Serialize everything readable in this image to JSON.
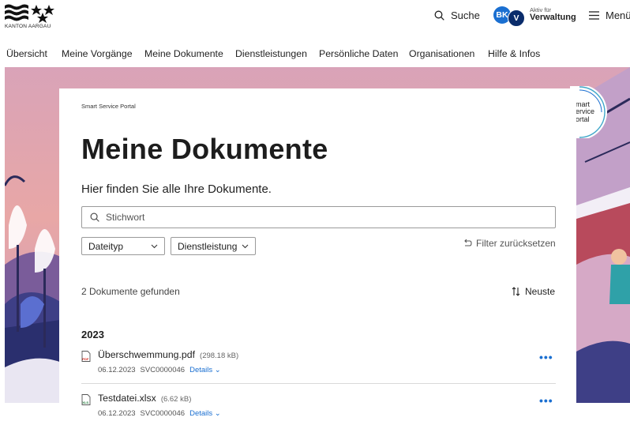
{
  "header": {
    "logo_text": "KANTON AARGAU",
    "search_label": "Suche",
    "avatar_initials": [
      "BK",
      "V"
    ],
    "role_sub": "Aktiv für",
    "role_main": "Verwaltung",
    "menu_label": "Menü"
  },
  "nav": {
    "items": [
      {
        "label": "Übersicht"
      },
      {
        "label": "Meine Vorgänge"
      },
      {
        "label": "Meine Dokumente"
      },
      {
        "label": "Dienstleistungen"
      },
      {
        "label": "Persönliche Daten"
      },
      {
        "label": "Organisationen"
      },
      {
        "label": "Hilfe & Infos"
      }
    ]
  },
  "badge": {
    "lines": [
      "mart",
      "ervice",
      "ortal"
    ]
  },
  "main": {
    "breadcrumb": "Smart Service Portal",
    "title": "Meine Dokumente",
    "subtitle": "Hier finden Sie alle Ihre Dokumente.",
    "search_placeholder": "Stichwort",
    "filters": [
      {
        "label": "Dateityp"
      },
      {
        "label": "Dienstleistung"
      }
    ],
    "reset_label": "Filter zurücksetzen",
    "result_count": "2 Dokumente gefunden",
    "sort_label": "Neuste",
    "year": "2023",
    "documents": [
      {
        "name": "Überschwemmung.pdf",
        "size": "(298.18 kB)",
        "date": "06.12.2023",
        "ref": "SVC0000046",
        "details": "Details",
        "icon": "pdf-file-icon",
        "icon_label": "PDF"
      },
      {
        "name": "Testdatei.xlsx",
        "size": "(6.62 kB)",
        "date": "06.12.2023",
        "ref": "SVC0000046",
        "details": "Details",
        "icon": "xlsx-file-icon",
        "icon_label": "XLS"
      }
    ]
  },
  "colors": {
    "accent": "#1a6fd1",
    "navy": "#0a2c6b",
    "background_sky": "#e6a5a8"
  }
}
